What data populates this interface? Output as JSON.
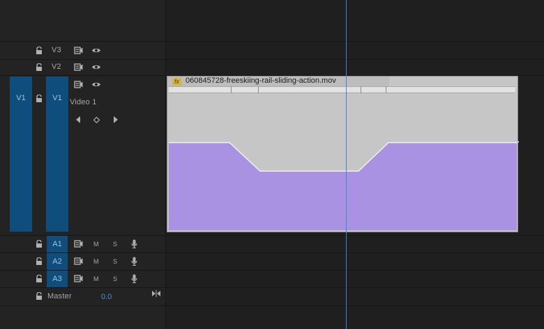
{
  "tracks": {
    "video": [
      {
        "id": "V3",
        "label": "V3"
      },
      {
        "id": "V2",
        "label": "V2"
      },
      {
        "id": "V1",
        "label": "V1",
        "source_label": "V1",
        "name": "Video 1"
      }
    ],
    "audio": [
      {
        "id": "A1",
        "label": "A1",
        "mute": "M",
        "solo": "S"
      },
      {
        "id": "A2",
        "label": "A2",
        "mute": "M",
        "solo": "S"
      },
      {
        "id": "A3",
        "label": "A3",
        "mute": "M",
        "solo": "S"
      }
    ],
    "master": {
      "label": "Master",
      "value": "0.0"
    }
  },
  "clip": {
    "fx_badge": "fx",
    "title": "060845728-freeskiing-rail-sliding-action.mov",
    "fill_color": "#a992e2",
    "header_color": "#c6c6c6"
  },
  "colors": {
    "track_target_blue": "#0f4d7d",
    "playhead": "#3d84e0"
  }
}
